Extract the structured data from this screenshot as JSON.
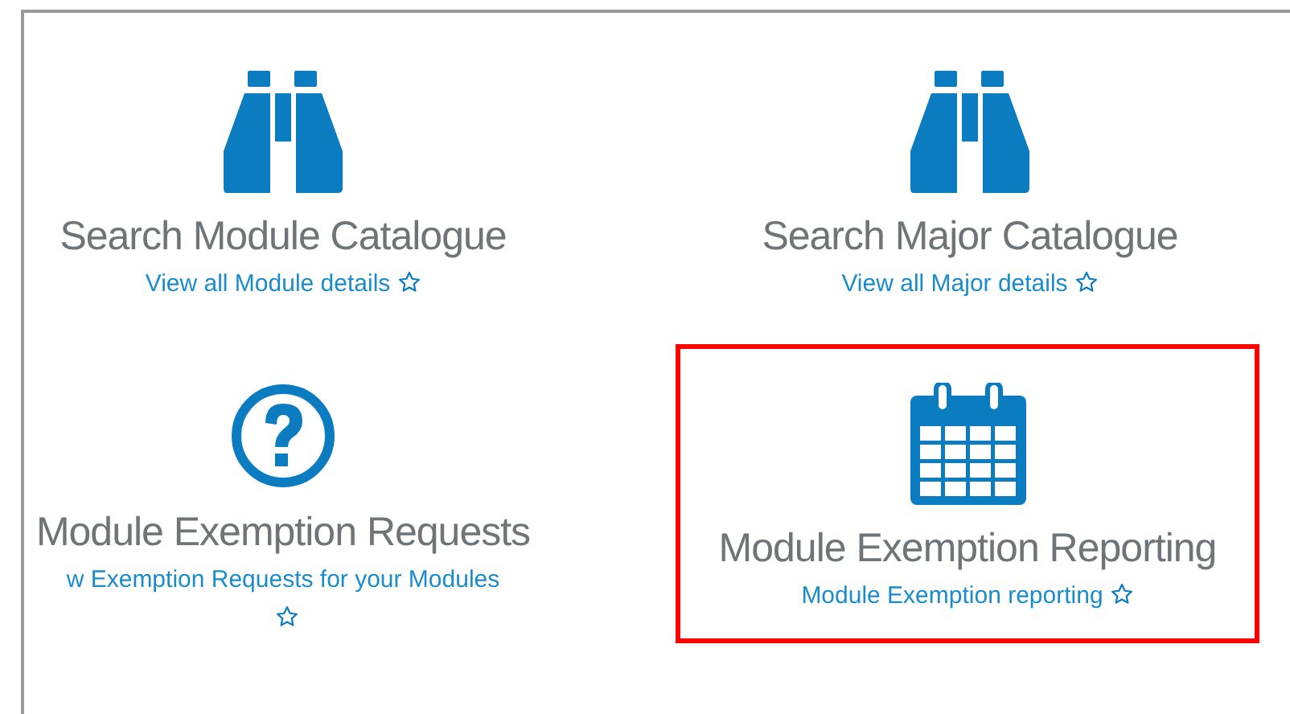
{
  "tiles": [
    {
      "kind": "binoculars",
      "title": "Search Module Catalogue",
      "link": "View all Module details",
      "highlighted": false
    },
    {
      "kind": "binoculars",
      "title": "Search Major Catalogue",
      "link": "View all Major details",
      "highlighted": false
    },
    {
      "kind": "question",
      "title": "Module Exemption Requests",
      "link": "w Exemption Requests for your Modules",
      "highlighted": false
    },
    {
      "kind": "calendar",
      "title": "Module Exemption Reporting",
      "link": "Module Exemption reporting",
      "highlighted": true
    }
  ]
}
